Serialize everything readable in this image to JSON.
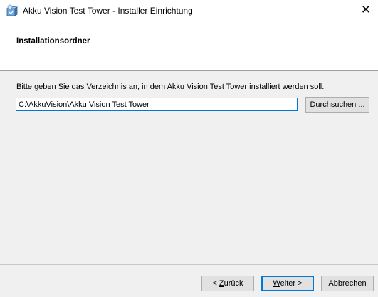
{
  "window": {
    "title": "Akku Vision Test Tower - Installer Einrichtung",
    "close_glyph": "✕"
  },
  "header": {
    "title": "Installationsordner"
  },
  "content": {
    "instruction": "Bitte geben Sie das Verzeichnis an, in dem Akku Vision Test Tower installiert werden soll.",
    "install_path": "C:\\AkkuVision\\Akku Vision Test Tower",
    "browse": {
      "mnemonic": "D",
      "rest": "urchsuchen ..."
    }
  },
  "footer": {
    "back": {
      "prefix": "< ",
      "mnemonic": "Z",
      "rest": "urück"
    },
    "next": {
      "mnemonic": "W",
      "rest": "eiter >"
    },
    "cancel": "Abbrechen"
  },
  "colors": {
    "accent": "#0078d7",
    "dialog_bg": "#f0f0f0",
    "button_bg": "#e1e1e1"
  },
  "icons": {
    "app": "installer-package-icon",
    "close": "close-icon"
  }
}
